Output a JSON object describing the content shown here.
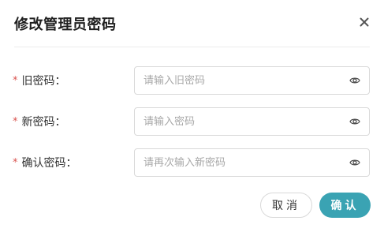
{
  "dialog": {
    "title": "修改管理员密码",
    "close_icon": "close-icon"
  },
  "form": {
    "required_mark": "*",
    "old_password": {
      "label": "旧密码：",
      "placeholder": "请输入旧密码",
      "value": "",
      "toggle_icon": "eye-icon"
    },
    "new_password": {
      "label": "新密码：",
      "placeholder": "请输入密码",
      "value": "",
      "toggle_icon": "eye-icon"
    },
    "confirm_password": {
      "label": "确认密码：",
      "placeholder": "请再次输入新密码",
      "value": "",
      "toggle_icon": "eye-icon"
    }
  },
  "footer": {
    "cancel_label": "取消",
    "ok_label": "确认"
  },
  "colors": {
    "accent": "#3aa3b3",
    "required": "#d9534f",
    "border": "#d9d9d9",
    "divider": "#ececec"
  }
}
